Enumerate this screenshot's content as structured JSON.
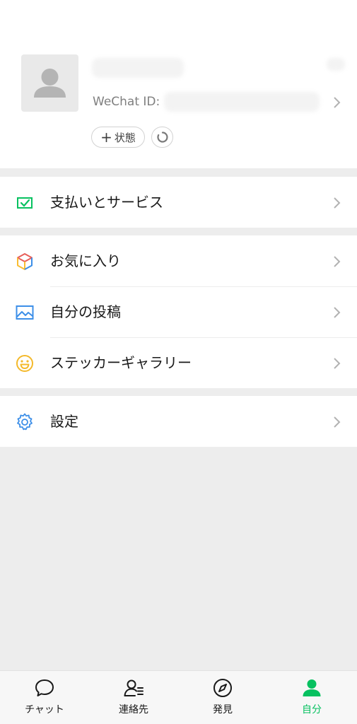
{
  "profile": {
    "wechat_id_label": "WeChat ID: ",
    "status_button": "状態",
    "status_plus": "+"
  },
  "menu": {
    "payments": "支払いとサービス",
    "favorites": "お気に入り",
    "moments": "自分の投稿",
    "stickers": "ステッカーギャラリー",
    "settings": "設定"
  },
  "tabs": [
    {
      "label": "チャット",
      "icon": "chat-bubble-icon"
    },
    {
      "label": "連絡先",
      "icon": "contacts-icon"
    },
    {
      "label": "発見",
      "icon": "compass-icon"
    },
    {
      "label": "自分",
      "icon": "person-icon",
      "active": true
    }
  ],
  "colors": {
    "accent_green": "#07c160",
    "background": "#ededed",
    "favorites_icon": [
      "#e75e58",
      "#fabd32",
      "#3d8fe8"
    ],
    "moments_icon": "#3d8fe8",
    "stickers_icon": "#f4b92b",
    "settings_icon": "#3d8fe8"
  }
}
